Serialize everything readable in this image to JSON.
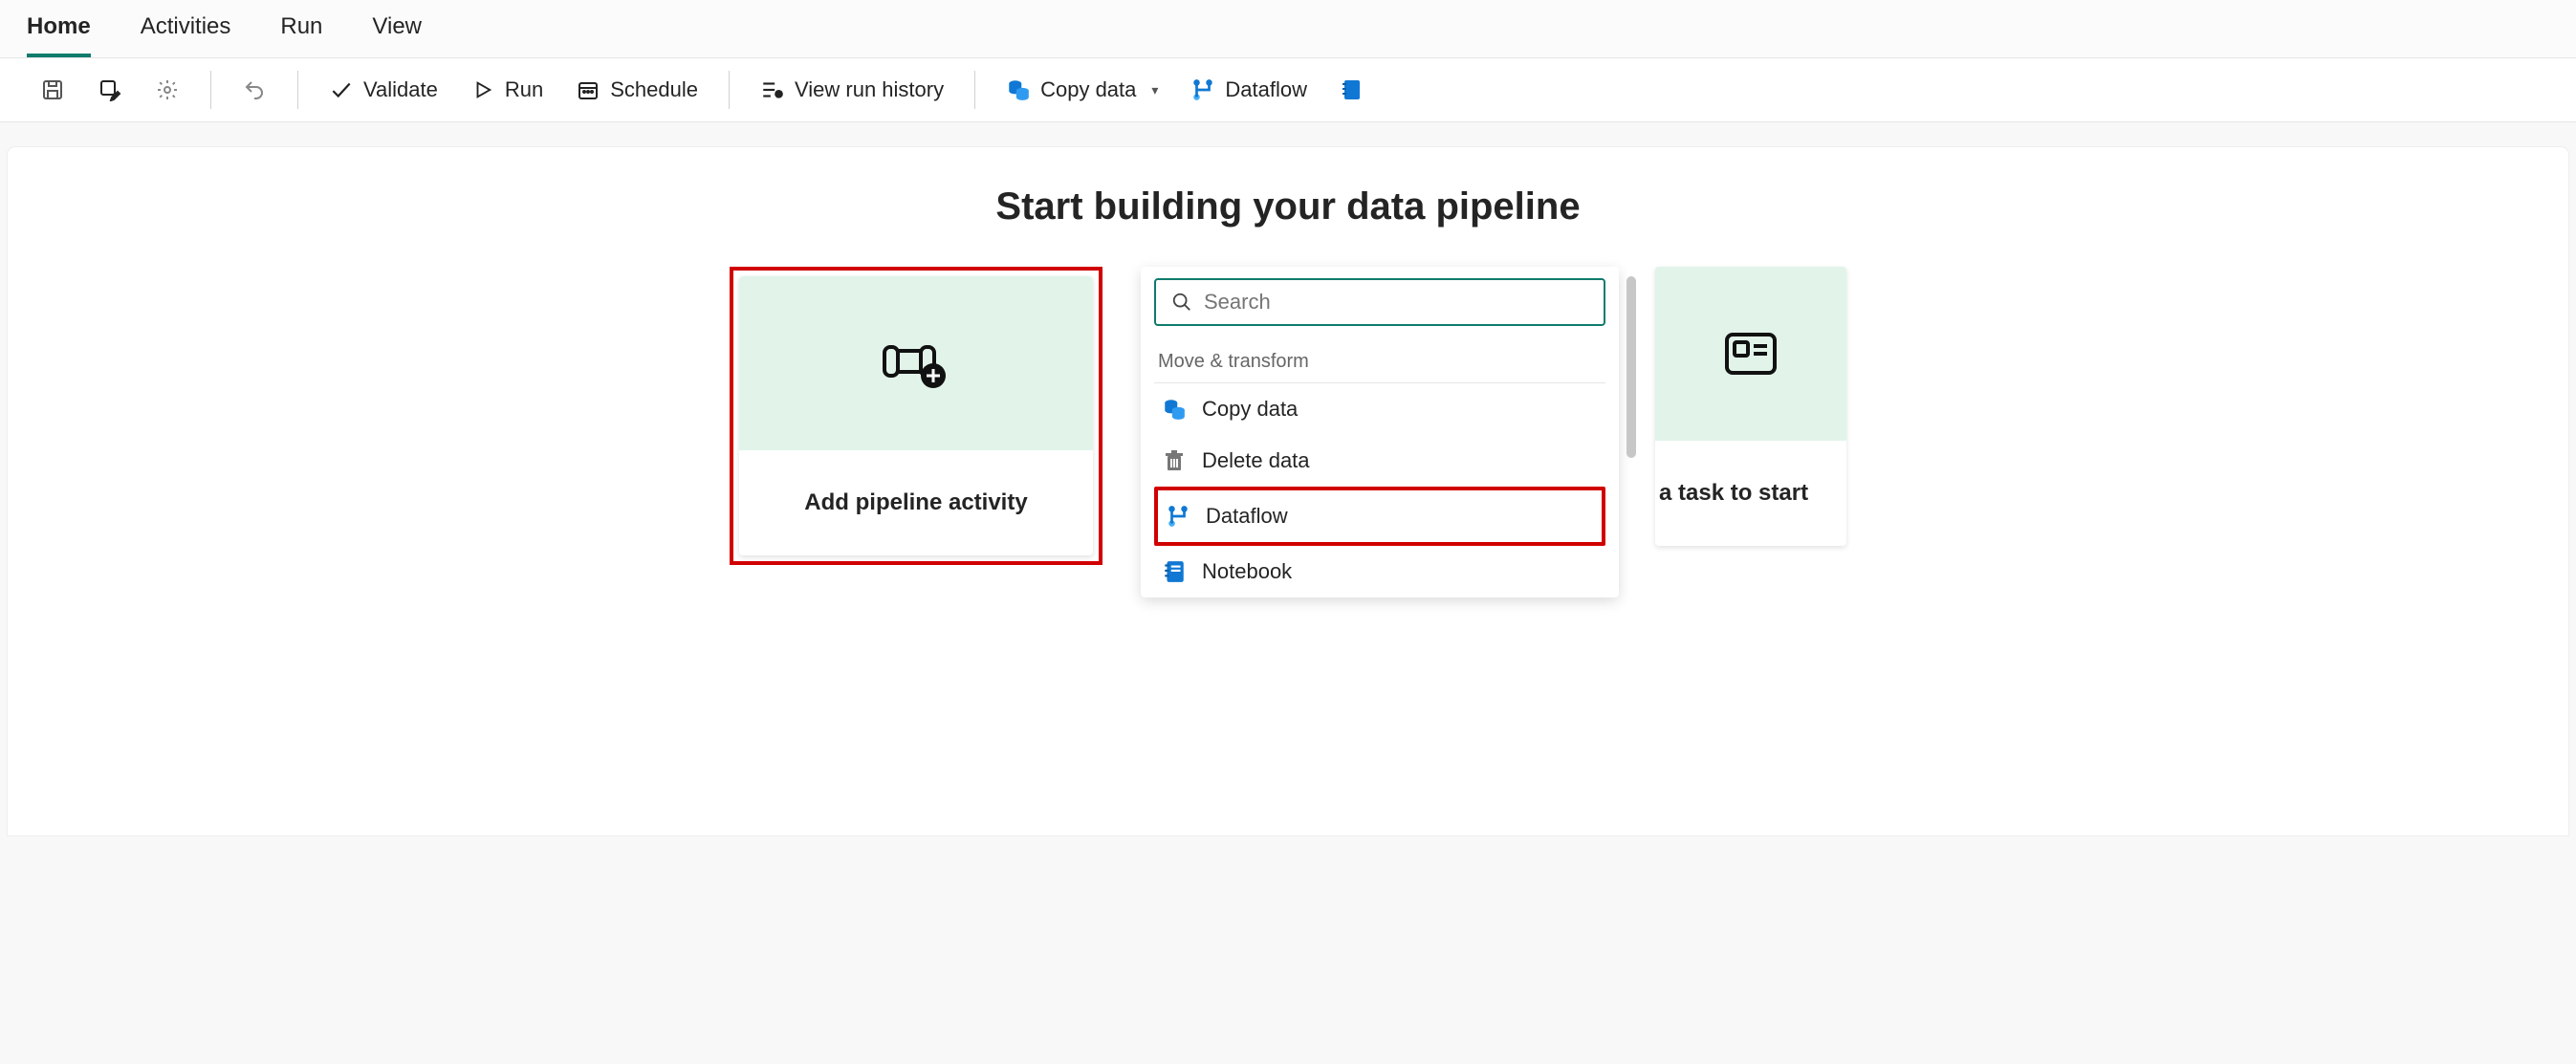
{
  "tabs": {
    "home": "Home",
    "activities": "Activities",
    "run": "Run",
    "view": "View",
    "active": "home"
  },
  "toolbar": {
    "validate": "Validate",
    "run": "Run",
    "schedule": "Schedule",
    "viewRunHistory": "View run history",
    "copyData": "Copy data",
    "dataflow": "Dataflow"
  },
  "main": {
    "heading": "Start building your data pipeline",
    "card_add_activity": "Add pipeline activity",
    "card_choose_task": "a task to start"
  },
  "panel": {
    "search_placeholder": "Search",
    "group_label": "Move & transform",
    "items": {
      "copy_data": "Copy data",
      "delete_data": "Delete data",
      "dataflow": "Dataflow",
      "notebook": "Notebook"
    }
  }
}
